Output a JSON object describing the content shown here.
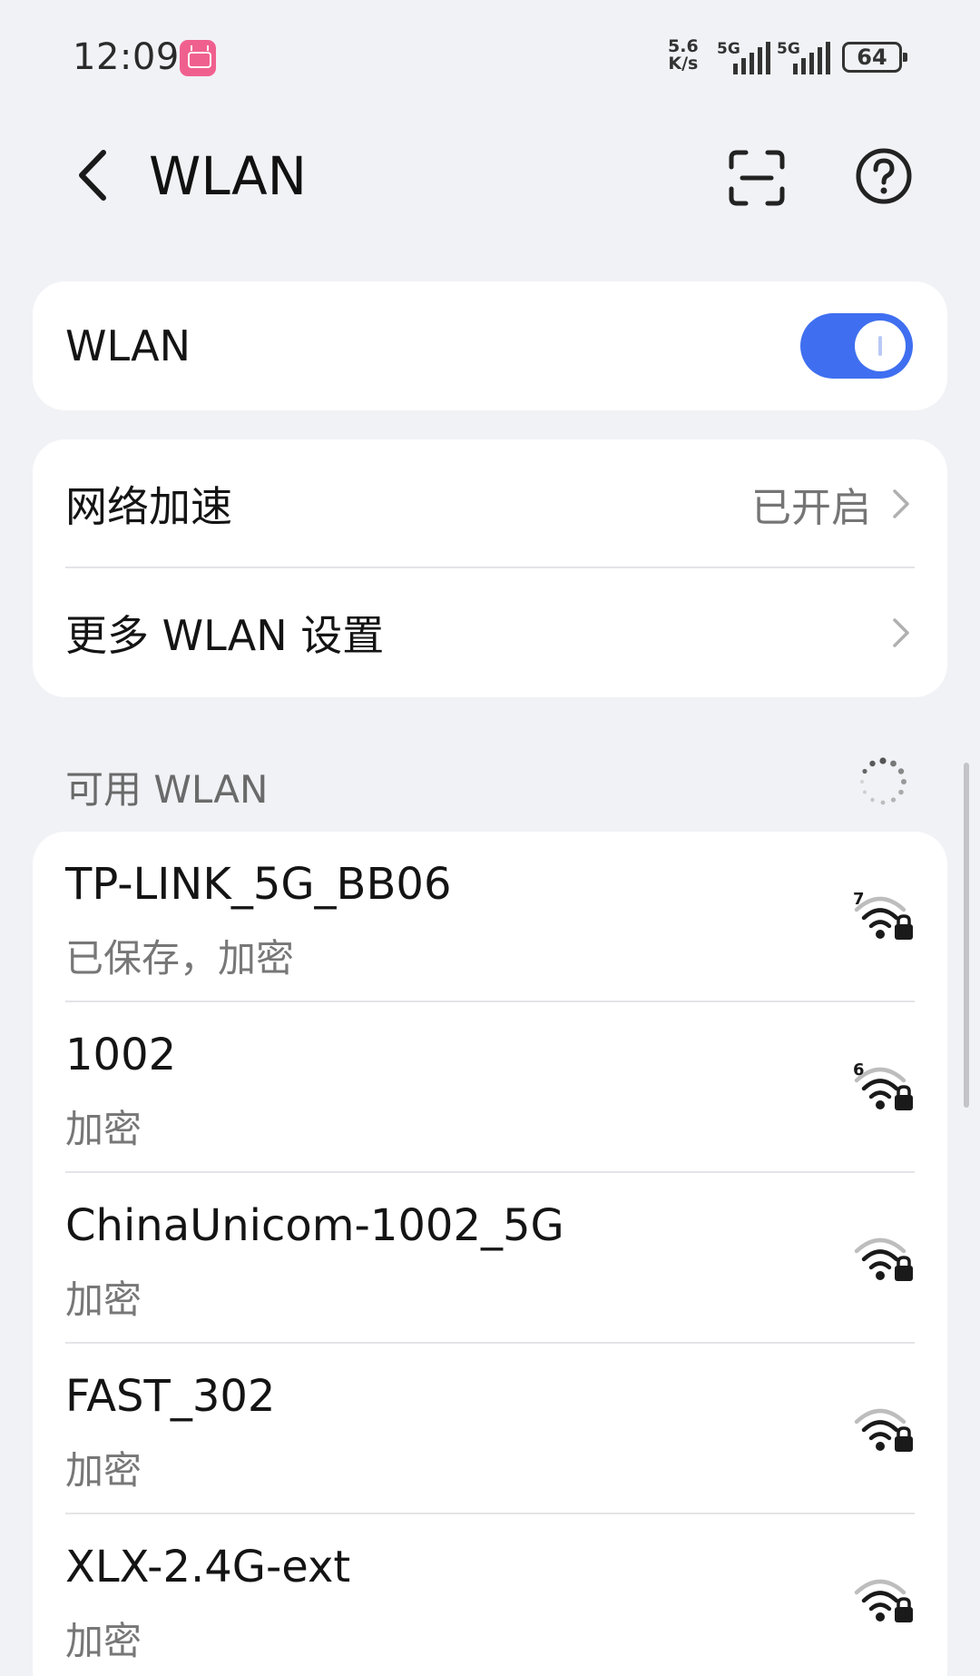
{
  "status_bar": {
    "time": "12:09",
    "speed_value": "5.6",
    "speed_unit": "K/s",
    "sim1_label": "5G",
    "sim2_label": "5G",
    "battery": "64"
  },
  "header": {
    "title": "WLAN",
    "back_icon": "chevron-left-icon",
    "scan_icon": "scan-icon",
    "help_icon": "help-circle-icon"
  },
  "wlan_toggle": {
    "label": "WLAN",
    "on": true,
    "accent": "#3f6ff0"
  },
  "settings": {
    "accel_label": "网络加速",
    "accel_value": "已开启",
    "more_label": "更多 WLAN 设置"
  },
  "available": {
    "heading": "可用 WLAN",
    "networks": [
      {
        "name": "TP-LINK_5G_BB06",
        "status": "已保存，加密",
        "badge": "7"
      },
      {
        "name": "1002",
        "status": "加密",
        "badge": "6"
      },
      {
        "name": "ChinaUnicom-1002_5G",
        "status": "加密",
        "badge": ""
      },
      {
        "name": "FAST_302",
        "status": "加密",
        "badge": ""
      },
      {
        "name": "XLX-2.4G-ext",
        "status": "加密",
        "badge": ""
      }
    ]
  }
}
